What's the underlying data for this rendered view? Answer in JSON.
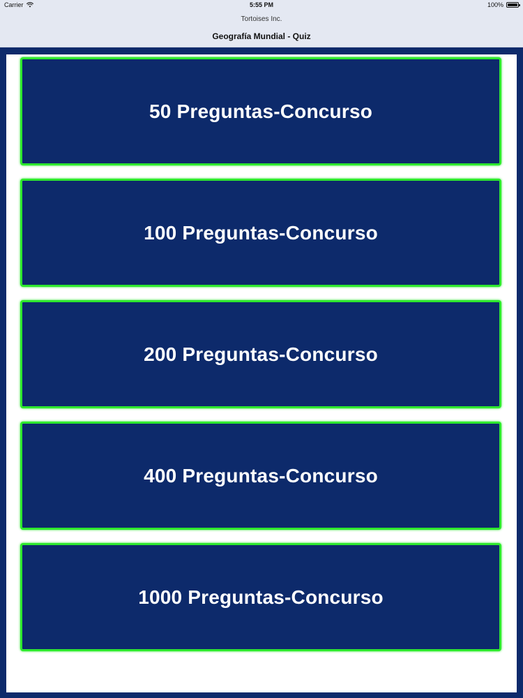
{
  "status_bar": {
    "carrier": "Carrier",
    "time": "5:55 PM",
    "battery": "100%"
  },
  "nav": {
    "subtitle": "Tortoises Inc.",
    "title": "Geografía Mundial - Quiz"
  },
  "quiz_options": [
    {
      "label": "50 Preguntas-Concurso"
    },
    {
      "label": "100 Preguntas-Concurso"
    },
    {
      "label": "200 Preguntas-Concurso"
    },
    {
      "label": "400 Preguntas-Concurso"
    },
    {
      "label": "1000 Preguntas-Concurso"
    }
  ],
  "colors": {
    "background": "#0d2a6b",
    "button_fill": "#0d2a6b",
    "button_border": "#2ee82e",
    "content_bg": "#ffffff",
    "bar_bg": "#e4e8f2"
  }
}
